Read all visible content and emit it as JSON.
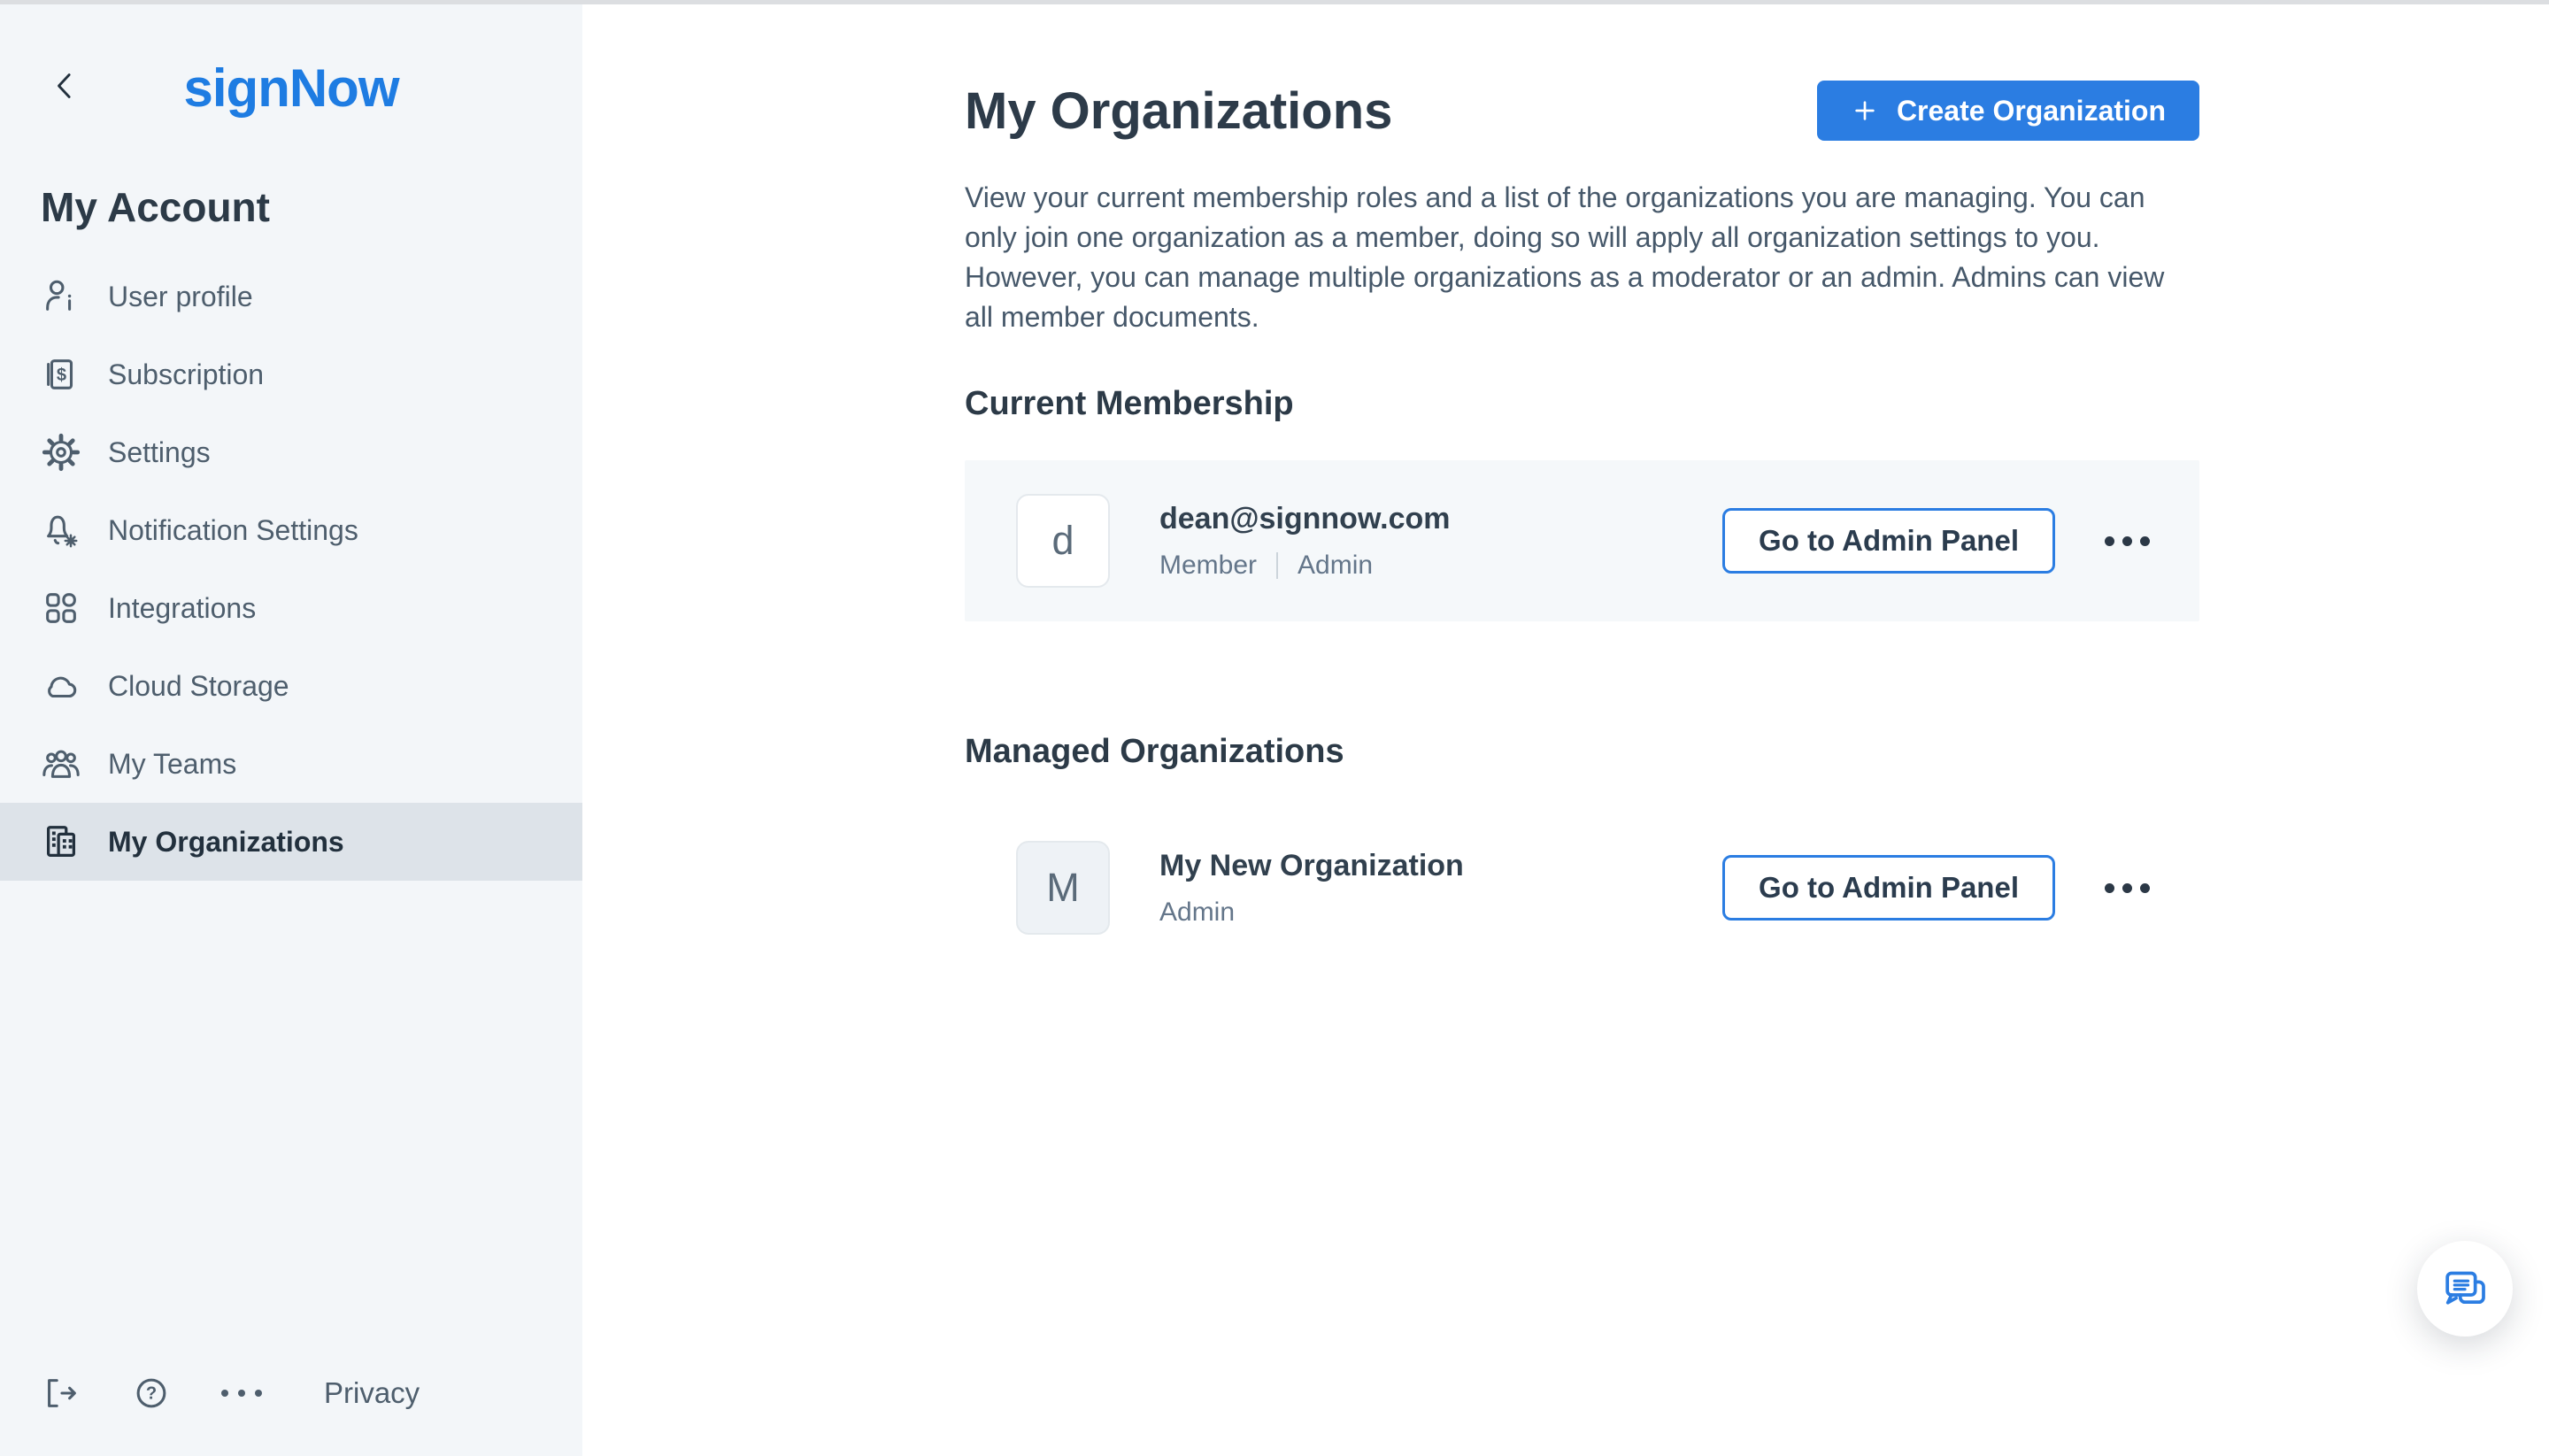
{
  "brand": {
    "logo": "signNow"
  },
  "sidebar": {
    "title": "My Account",
    "items": [
      {
        "label": "User profile",
        "icon": "user-profile-icon",
        "active": false
      },
      {
        "label": "Subscription",
        "icon": "subscription-icon",
        "active": false
      },
      {
        "label": "Settings",
        "icon": "settings-icon",
        "active": false
      },
      {
        "label": "Notification Settings",
        "icon": "notification-settings-icon",
        "active": false
      },
      {
        "label": "Integrations",
        "icon": "integrations-icon",
        "active": false
      },
      {
        "label": "Cloud Storage",
        "icon": "cloud-storage-icon",
        "active": false
      },
      {
        "label": "My Teams",
        "icon": "my-teams-icon",
        "active": false
      },
      {
        "label": "My Organizations",
        "icon": "my-organizations-icon",
        "active": true
      }
    ],
    "footer": {
      "privacy": "Privacy"
    }
  },
  "main": {
    "title": "My Organizations",
    "create_button": "Create Organization",
    "description": "View your current membership roles and a list of the organizations you are managing. You can only join one organization as a member, doing so will apply all organization settings to you. However, you can manage multiple organizations as a moderator or an admin. Admins can view all member documents.",
    "current_membership": {
      "heading": "Current Membership",
      "row": {
        "avatar": "d",
        "title": "dean@signnow.com",
        "role_1": "Member",
        "role_2": "Admin",
        "action": "Go to Admin Panel"
      }
    },
    "managed_organizations": {
      "heading": "Managed Organizations",
      "row": {
        "avatar": "M",
        "title": "My New Organization",
        "role_1": "Admin",
        "action": "Go to Admin Panel"
      }
    }
  },
  "colors": {
    "accent_blue": "#2b7de2",
    "logo_blue": "#1e7ce2",
    "sidebar_bg": "#f3f6f9",
    "active_item_bg": "#dde3e9",
    "card_bg": "#f5f8fa",
    "dark_text": "#2c3a47",
    "slate_text": "#4e5e6d",
    "muted_text": "#64768a"
  }
}
